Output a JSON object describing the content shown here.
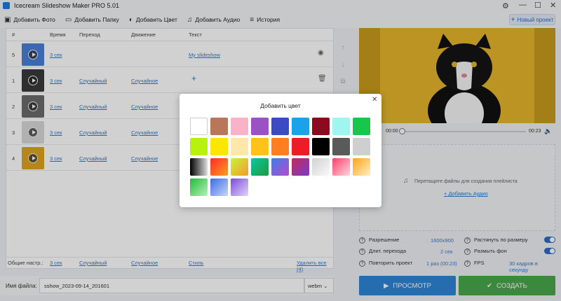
{
  "app": {
    "title": "Icecream Slideshow Maker PRO 5.01"
  },
  "icons": {
    "gear": "gear-icon",
    "minimize": "minimize-icon",
    "maximize": "maximize-icon",
    "close": "close-icon"
  },
  "toolbar": {
    "items": [
      {
        "label": "Добавить Фото",
        "icon": "photo-icon",
        "glyph": "▣"
      },
      {
        "label": "Добавить Папку",
        "icon": "folder-icon",
        "glyph": "▭"
      },
      {
        "label": "Добавить Цвет",
        "icon": "palette-icon",
        "glyph": "◐"
      },
      {
        "label": "Добавить Аудио",
        "icon": "music-icon",
        "glyph": "♫"
      },
      {
        "label": "История",
        "icon": "history-icon",
        "glyph": "≡"
      }
    ],
    "new_project": "Новый проект"
  },
  "table": {
    "headers": {
      "num": "#",
      "time": "Время",
      "transition": "Переход",
      "motion": "Движение",
      "text": "Текст"
    },
    "rows": [
      {
        "num": "5",
        "time": "3 сек",
        "transition": "",
        "motion": "",
        "text": "My slideshow",
        "thumb": "#4a7fd8",
        "action": "eye-icon"
      },
      {
        "num": "1",
        "time": "3 сек",
        "transition": "Случайный",
        "motion": "Случайное",
        "text": "",
        "thumb": "#3a3a3a",
        "action": "trash-icon"
      },
      {
        "num": "2",
        "time": "3 сек",
        "transition": "Случайный",
        "motion": "Случайное",
        "text": "",
        "thumb": "#6b6b6b",
        "action": ""
      },
      {
        "num": "3",
        "time": "3 сек",
        "transition": "Случайный",
        "motion": "Случайное",
        "text": "",
        "thumb": "#d8d8d8",
        "action": ""
      },
      {
        "num": "4",
        "time": "3 сек",
        "transition": "Случайный",
        "motion": "Случайное",
        "text": "",
        "thumb": "#e0a41e",
        "action": ""
      }
    ],
    "footer": {
      "label": "Общие настр.:",
      "time": "3 сек",
      "transition": "Случайный",
      "motion": "Случайное",
      "style": "Стиль",
      "delete_all": "Удалить все (4)"
    }
  },
  "filename": {
    "label": "Имя файла:",
    "value": "sshow_2023-09-14_201601",
    "ext": "webm"
  },
  "player": {
    "time_current": "00:00",
    "time_total": "00:23",
    "progress": 0
  },
  "playlist": {
    "hint": "Перетащите файлы для создания плейлиста",
    "add_audio": "Добавить Аудио"
  },
  "settings": {
    "resolution_label": "Разрешение",
    "resolution_value": "1600x900",
    "transition_label": "Длит. перехода",
    "transition_value": "2 сек",
    "repeat_label": "Повторить проект",
    "repeat_value": "1 раз (00:23)",
    "stretch_label": "Растянуть по размеру",
    "stretch_on": true,
    "blur_label": "Размыть фон",
    "blur_on": true,
    "fps_label": "FPS",
    "fps_value": "30 кадров в секунду"
  },
  "buttons": {
    "preview": "ПРОСМОТР",
    "create": "СОЗДАТЬ"
  },
  "dialog": {
    "title": "Добавить цвет",
    "swatches": [
      "#ffffff",
      "#b8775a",
      "#f8b3c8",
      "#9a52c4",
      "#3b4bc4",
      "#1aa3e8",
      "#8b0a1e",
      "#9ff6f0",
      "#17c64a",
      "#b8f20a",
      "#ffe600",
      "#fde8a8",
      "#ffc21a",
      "#ff7f1e",
      "#ee1c24",
      "#000000",
      "#5a5a5a",
      "#cfcfcf",
      "linear-gradient(90deg,#000,#ddd)",
      "linear-gradient(135deg,#ff2a2a,#ff9d1e)",
      "linear-gradient(135deg,#c7f33a,#f59b2a)",
      "linear-gradient(135deg,#0fc6a0,#1a9a3e)",
      "linear-gradient(135deg,#3e7ee8,#b54ad0)",
      "linear-gradient(135deg,#c22b5a,#7a3ac8)",
      "linear-gradient(135deg,#d2d2d2,#f8f8f8)",
      "linear-gradient(135deg,#ff3f6a,#ffd6df)",
      "linear-gradient(135deg,#ffa31a,#fff0c0)",
      "linear-gradient(135deg,#22b93a,#b6f2b8)",
      "linear-gradient(135deg,#3c6de0,#c7d4fb)",
      "linear-gradient(135deg,#7b4bd6,#e4d4fb)"
    ]
  }
}
